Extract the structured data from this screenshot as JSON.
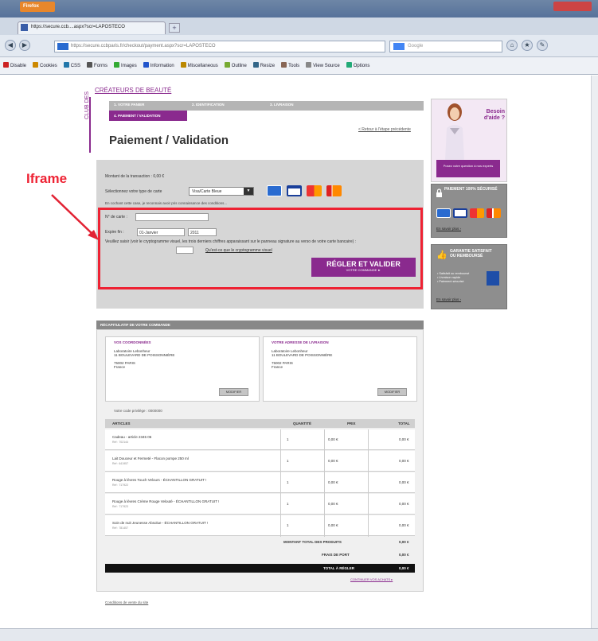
{
  "browser": {
    "app_button": "Firefox",
    "tab_title": "https://secure.ccb....aspx?scr=LAPOSTECO",
    "url": "https://secure.ccbparis.fr/checkout/payment.aspx?scr=LAPOSTECO",
    "search_placeholder": "Google",
    "toolbar_items": [
      "Disable",
      "Cookies",
      "CSS",
      "Forms",
      "Images",
      "Information",
      "Miscellaneous",
      "Outline",
      "Resize",
      "Tools",
      "View Source",
      "Options"
    ]
  },
  "site": {
    "brand": "CRÉATEURS DE BEAUTÉ",
    "brand_vertical": "CLUB DES",
    "steps": [
      "1. VOTRE PANIER",
      "2. IDENTIFICATION",
      "3. LIVRAISON"
    ],
    "active_step": "4. PAIEMENT / VALIDATION",
    "back_link": "< Retour à l'étape précédente",
    "page_title": "Paiement / Validation"
  },
  "payment": {
    "amount_label": "Montant de la transaction : 0,00 €",
    "card_type_label": "Sélectionnez votre type de carte",
    "card_type_value": "Visa/Carte Bleue",
    "remember_text": "En cochant cette case, je reconnais avoir pris connaissance des conditions...",
    "card_number_label": "N° de carte :",
    "expiry_label": "Expire fin :",
    "expiry_month": "01-Janvier",
    "expiry_year": "2011",
    "cvv_text": "Veuillez saisir (voir le cryptogramme visuel, les trois derniers chiffres apparaissant sur le panneau signature au verso de votre carte bancaire) :",
    "cvv_link": "Qu'est-ce que le cryptogramme visuel",
    "pay_button": "RÉGLER ET VALIDER",
    "pay_button_sub": "VOTRE COMMANDE ►"
  },
  "annotation": {
    "label": "Iframe",
    "color": "#e22233"
  },
  "recap": {
    "header": "RÉCAPITULATIF DE VOTRE COMMANDE",
    "billing": {
      "title": "VOS COORDONNÉES",
      "lines": [
        "Laboratoire Lebonheur",
        "11 BOULEVARD DE POISSONNIÈRE",
        "75002 PARIS",
        "France"
      ],
      "modify": "MODIFIER"
    },
    "shipping": {
      "title": "VOTRE ADRESSE DE LIVRAISON",
      "lines": [
        "Laboratoire Lebonheur",
        "11 BOULEVARD DE POISSONNIÈRE",
        "75002 PARIS",
        "France"
      ],
      "modify": "MODIFIER"
    },
    "promo": "Votre code privilège : 0000000",
    "columns": [
      "ARTICLES",
      "QUANTITÉ",
      "PRIX",
      "TOTAL"
    ],
    "products": [
      {
        "name": "Cadeau - article 2345 06",
        "ref": "Réf : 702144",
        "qty": "1",
        "price": "0,00 €",
        "total": "0,00 €"
      },
      {
        "name": "Lait Douceur et Fermeté - Flacon pompe 250 ml",
        "ref": "Réf : 641957",
        "qty": "1",
        "price": "0,00 €",
        "total": "0,00 €"
      },
      {
        "name": "Rouge à lèvres Touch Velours - ÉCHANTILLON GRATUIT !",
        "ref": "Réf : 717922",
        "qty": "1",
        "price": "0,00 €",
        "total": "0,00 €"
      },
      {
        "name": "Rouge à lèvres Crème Rouge Velouté - ÉCHANTILLON GRATUIT !",
        "ref": "Réf : 717923",
        "qty": "1",
        "price": "0,00 €",
        "total": "0,00 €"
      },
      {
        "name": "Soin de nuit Jeunesse Absolue - ÉCHANTILLON GRATUIT !",
        "ref": "Réf : 781457",
        "qty": "1",
        "price": "0,00 €",
        "total": "0,00 €"
      }
    ],
    "subtotal_label": "MONTANT TOTAL DES PRODUITS",
    "subtotal_value": "0,00 €",
    "shipping_label": "FRAIS DE PORT",
    "shipping_value": "0,00 €",
    "total_label": "TOTAL À RÉGLER",
    "total_value": "0,00 €",
    "continue_link": "CONTINUER VOS ACHATS ▸",
    "cgv_link": "Conditions de vente du site"
  },
  "sidebar": {
    "help_title": "Besoin d'aide ?",
    "help_cta": "Posez votre question à nos experts",
    "secure_title": "PAIEMENT 100% SÉCURISÉ",
    "secure_more": "En savoir plus ›",
    "reassure_title": "GARANTIE SATISFAIT OU REMBOURSÉ",
    "reassure_items": [
      "• Satisfait ou remboursé",
      "• Livraison rapide",
      "• Paiement sécurisé"
    ],
    "reassure_more": "En savoir plus ›"
  },
  "colors": {
    "brand": "#8a2a8e",
    "highlight": "#e22233"
  }
}
